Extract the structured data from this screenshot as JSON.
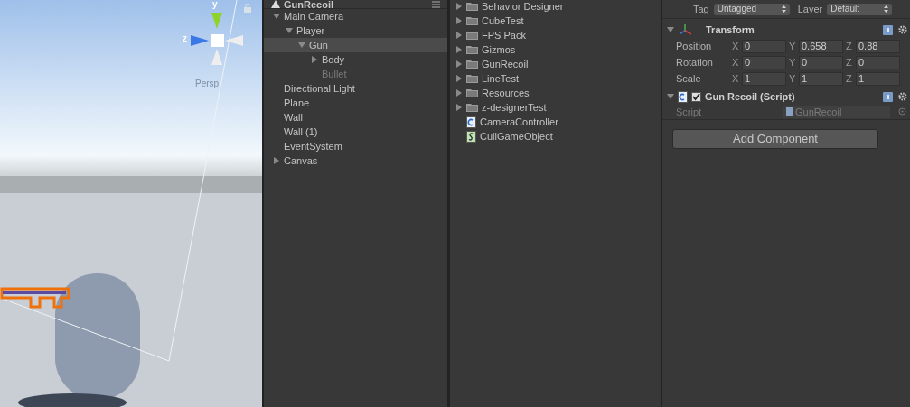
{
  "scene_view": {
    "axis_labels": [
      "y",
      "z"
    ],
    "projection": "Persp"
  },
  "hierarchy": {
    "scene": "GunRecoil",
    "items": [
      {
        "label": "Main Camera",
        "expanded": true,
        "selected": false,
        "active": true,
        "children": [
          {
            "label": "Player",
            "expanded": true,
            "selected": false,
            "active": true,
            "children": [
              {
                "label": "Gun",
                "expanded": true,
                "selected": true,
                "active": true,
                "children": [
                  {
                    "label": "Body",
                    "expanded": false,
                    "selected": false,
                    "active": true
                  },
                  {
                    "label": "Bullet",
                    "selected": false,
                    "active": false
                  }
                ]
              }
            ]
          }
        ]
      },
      {
        "label": "Directional Light",
        "selected": false,
        "active": true
      },
      {
        "label": "Plane",
        "selected": false,
        "active": true
      },
      {
        "label": "Wall",
        "selected": false,
        "active": true
      },
      {
        "label": "Wall (1)",
        "selected": false,
        "active": true
      },
      {
        "label": "EventSystem",
        "selected": false,
        "active": true
      },
      {
        "label": "Canvas",
        "expanded": false,
        "selected": false,
        "active": true
      }
    ]
  },
  "project": {
    "items": [
      {
        "label": "Behavior Designer",
        "kind": "folder"
      },
      {
        "label": "CubeTest",
        "kind": "folder"
      },
      {
        "label": "FPS Pack",
        "kind": "folder"
      },
      {
        "label": "Gizmos",
        "kind": "folder"
      },
      {
        "label": "GunRecoil",
        "kind": "folder"
      },
      {
        "label": "LineTest",
        "kind": "folder"
      },
      {
        "label": "Resources",
        "kind": "folder"
      },
      {
        "label": "z-designerTest",
        "kind": "folder"
      },
      {
        "label": "CameraController",
        "kind": "csharp"
      },
      {
        "label": "CullGameObject",
        "kind": "unityscript"
      }
    ]
  },
  "inspector": {
    "tag": {
      "label": "Tag",
      "value": "Untagged"
    },
    "layer": {
      "label": "Layer",
      "value": "Default"
    },
    "transform": {
      "title": "Transform",
      "rows": [
        {
          "label": "Position",
          "fields": [
            {
              "axis": "X",
              "value": "0"
            },
            {
              "axis": "Y",
              "value": "0.658"
            },
            {
              "axis": "Z",
              "value": "0.88"
            }
          ]
        },
        {
          "label": "Rotation",
          "fields": [
            {
              "axis": "X",
              "value": "0"
            },
            {
              "axis": "Y",
              "value": "0"
            },
            {
              "axis": "Z",
              "value": "0"
            }
          ]
        },
        {
          "label": "Scale",
          "fields": [
            {
              "axis": "X",
              "value": "1"
            },
            {
              "axis": "Y",
              "value": "1"
            },
            {
              "axis": "Z",
              "value": "1"
            }
          ]
        }
      ]
    },
    "script_component": {
      "title": "Gun Recoil (Script)",
      "enabled": true,
      "field_label": "Script",
      "field_value": "GunRecoil"
    },
    "add_component_button": "Add Component"
  }
}
